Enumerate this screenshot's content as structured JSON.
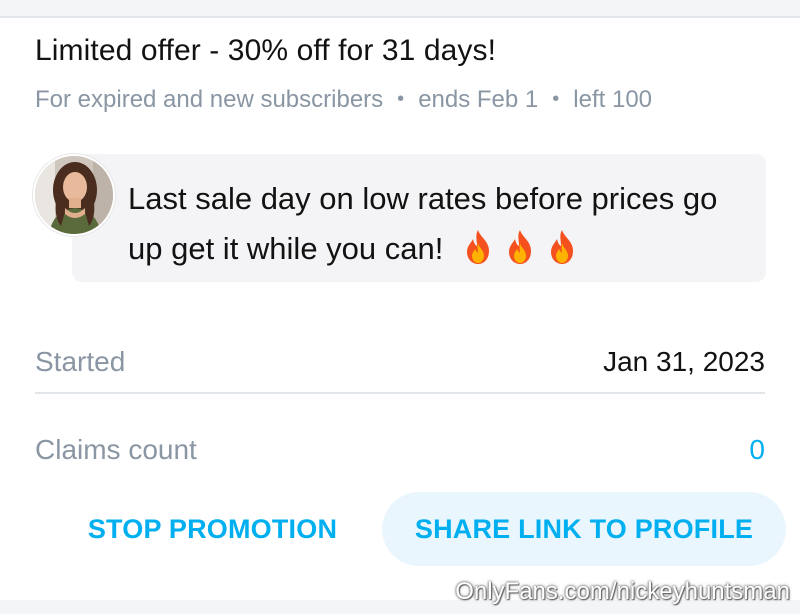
{
  "offer": {
    "title": "Limited offer - 30% off for 31 days!",
    "audience": "For expired and new subscribers",
    "ends": "ends Feb 1",
    "left": "left 100",
    "separator": "•"
  },
  "message": {
    "text": "Last sale day on low rates before prices go up get it while you can!",
    "emoji": [
      "fire-icon",
      "fire-icon",
      "fire-icon"
    ]
  },
  "details": {
    "started_label": "Started",
    "started_value": "Jan 31, 2023",
    "claims_label": "Claims count",
    "claims_value": "0"
  },
  "actions": {
    "stop_label": "STOP PROMOTION",
    "share_label": "SHARE LINK TO PROFILE"
  },
  "watermark": "OnlyFans.com/nickeyhuntsman",
  "colors": {
    "accent": "#00aff0",
    "muted": "#8a96a3",
    "text": "#121212",
    "bubble": "#f4f4f6",
    "share_bg": "#eaf6fd"
  }
}
